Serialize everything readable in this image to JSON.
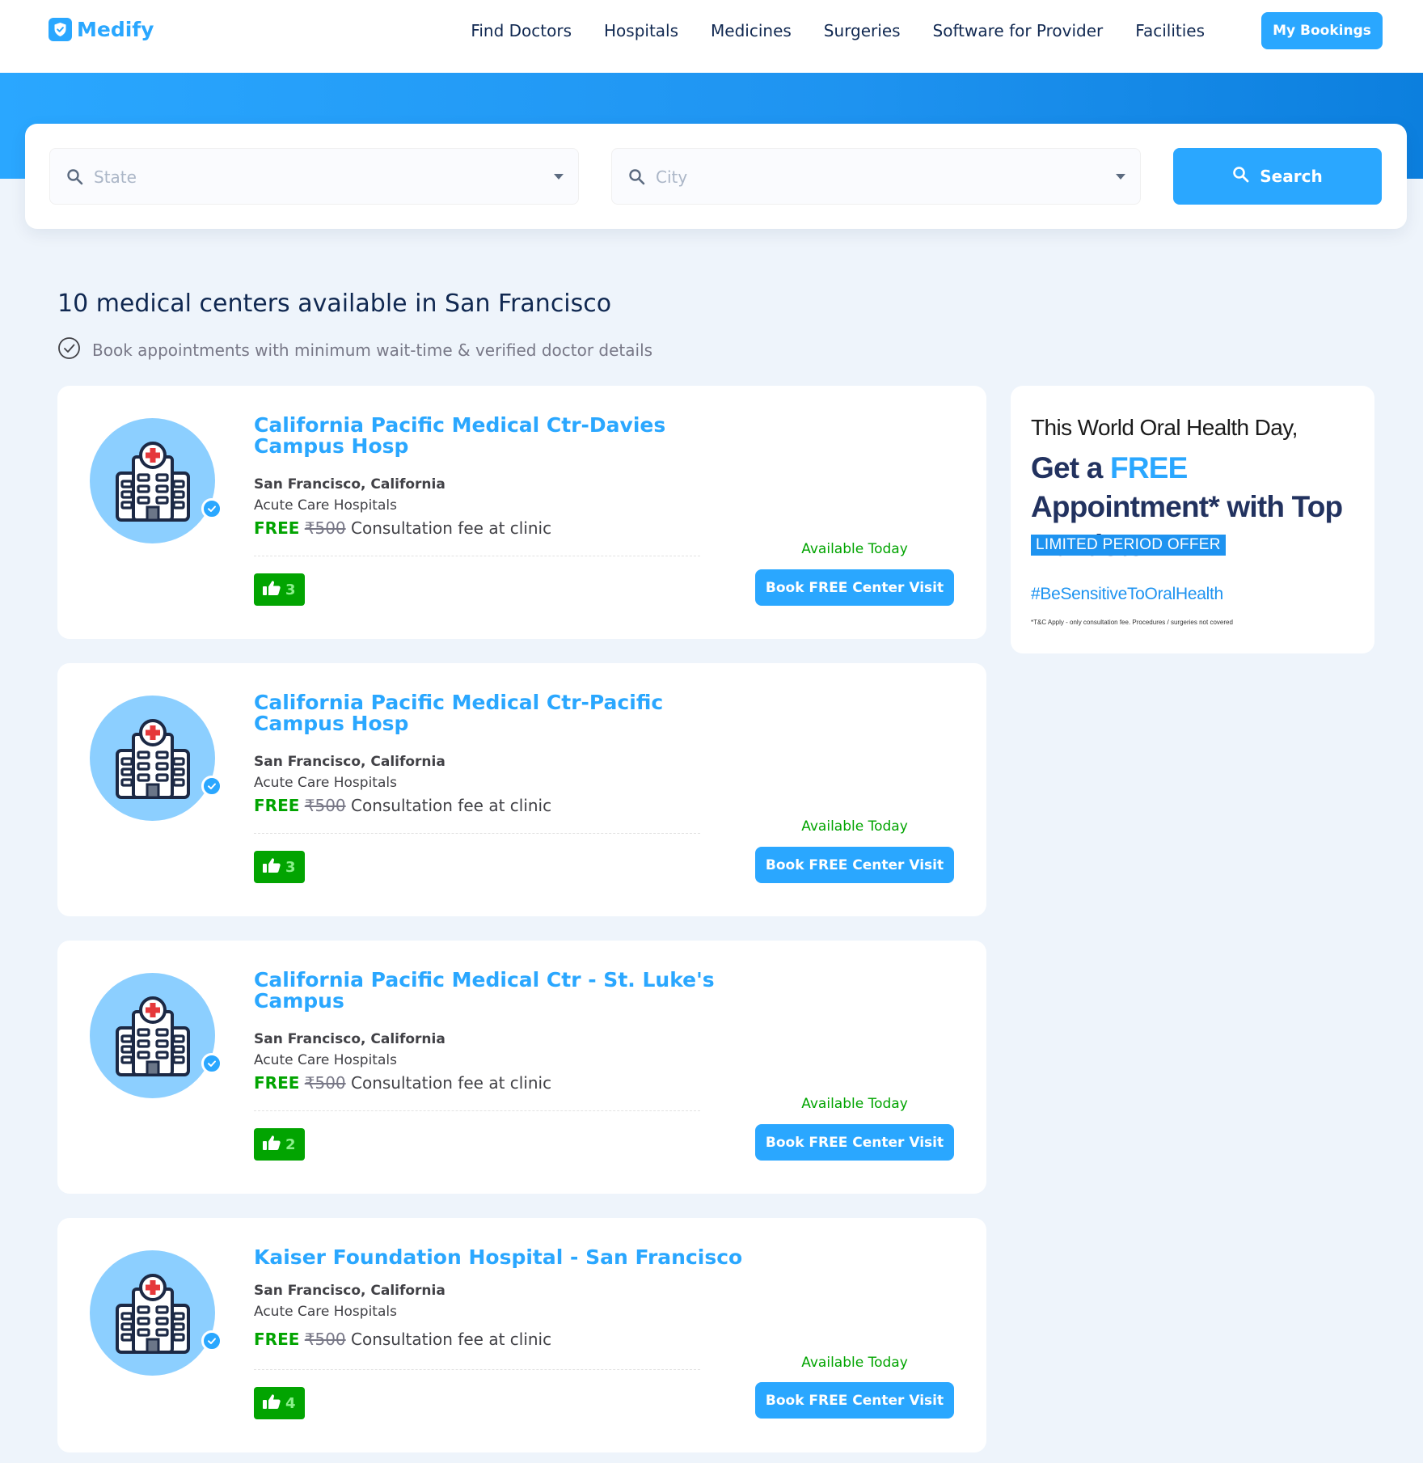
{
  "nav": {
    "brand": "Medify",
    "links": [
      "Find Doctors",
      "Hospitals",
      "Medicines",
      "Surgeries",
      "Software for Provider",
      "Facilities"
    ],
    "bookings_label": "My Bookings"
  },
  "search": {
    "state_placeholder": "State",
    "city_placeholder": "City",
    "button_label": "Search"
  },
  "results": {
    "heading": "10 medical centers available in San Francisco",
    "subline": "Book appointments with minimum wait-time & verified doctor details"
  },
  "centers": [
    {
      "name": "California Pacific Medical Ctr-Davies Campus Hosp",
      "location": "San Francisco, California",
      "type": "Acute Care Hospitals",
      "free": "FREE",
      "price": "₹500",
      "fee_text": " Consultation fee at clinic",
      "likes": "3",
      "availability": "Available Today",
      "book_label": "Book FREE Center Visit"
    },
    {
      "name": "California Pacific Medical Ctr-Pacific Campus Hosp",
      "location": "San Francisco, California",
      "type": "Acute Care Hospitals",
      "free": "FREE",
      "price": "₹500",
      "fee_text": " Consultation fee at clinic",
      "likes": "3",
      "availability": "Available Today",
      "book_label": "Book FREE Center Visit"
    },
    {
      "name": "California Pacific Medical Ctr - St. Luke's Campus",
      "location": "San Francisco, California",
      "type": "Acute Care Hospitals",
      "free": "FREE",
      "price": "₹500",
      "fee_text": " Consultation fee at clinic",
      "likes": "2",
      "availability": "Available Today",
      "book_label": "Book FREE Center Visit"
    },
    {
      "name": "Kaiser Foundation Hospital - San Francisco",
      "location": "San Francisco, California",
      "type": "Acute Care Hospitals",
      "free": "FREE",
      "price": "₹500",
      "fee_text": " Consultation fee at clinic",
      "likes": "4",
      "availability": "Available Today",
      "book_label": "Book FREE Center Visit"
    }
  ],
  "ad": {
    "line1": "This World Oral Health Day,",
    "line2_pre": "Get a ",
    "line2_accent": "FREE",
    "line2_post": " Appointment* with Top Dentists.",
    "offer": "LIMITED PERIOD OFFER",
    "hashtag": "#BeSensitiveToOralHealth",
    "tc": "*T&C Apply - only consultation fee. Procedures / surgeries not covered"
  },
  "colors": {
    "primary": "#2aa7ff",
    "navy": "#102851",
    "green": "#02a401",
    "page_bg": "#eef4fb"
  },
  "icons": [
    "shield-check-icon",
    "search-icon",
    "chevron-down-icon",
    "check-circle-icon",
    "hospital-icon",
    "verified-icon",
    "thumbs-up-icon"
  ]
}
